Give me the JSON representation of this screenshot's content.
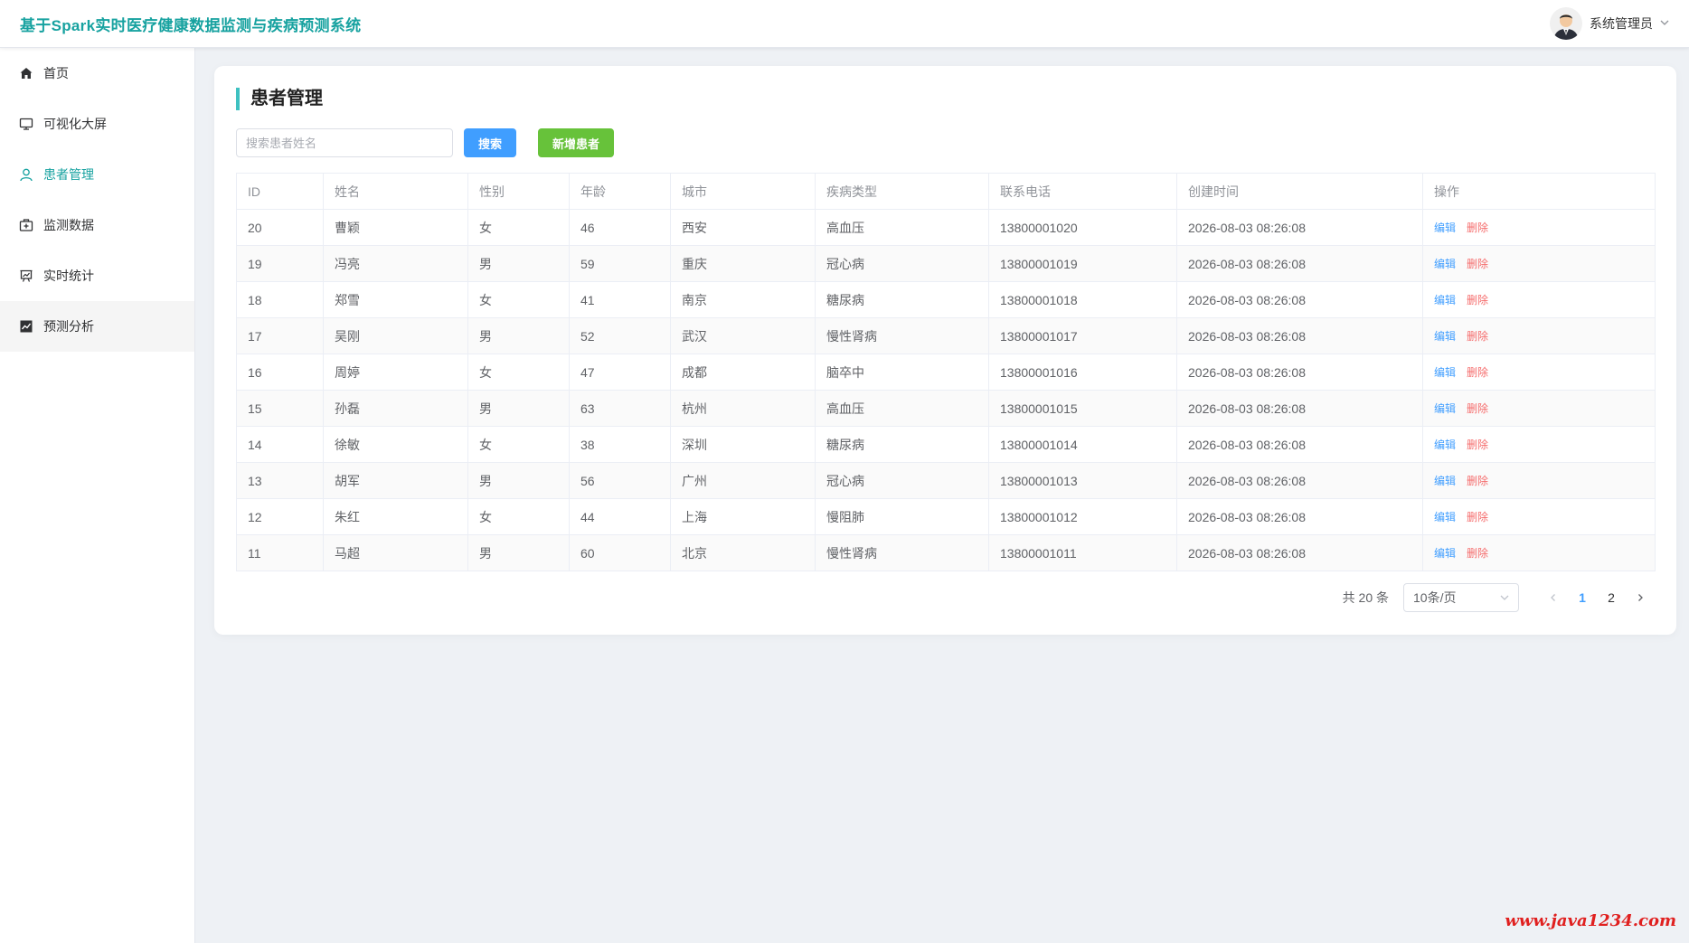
{
  "header": {
    "title": "基于Spark实时医疗健康数据监测与疾病预测系统",
    "user_name": "系统管理员"
  },
  "sidebar": {
    "items": [
      {
        "label": "首页",
        "icon": "home-icon"
      },
      {
        "label": "可视化大屏",
        "icon": "monitor-icon"
      },
      {
        "label": "患者管理",
        "icon": "user-icon"
      },
      {
        "label": "监测数据",
        "icon": "medical-kit-icon"
      },
      {
        "label": "实时统计",
        "icon": "presentation-chart-icon"
      },
      {
        "label": "预测分析",
        "icon": "trend-chart-icon"
      }
    ]
  },
  "main": {
    "page_title": "患者管理",
    "search_placeholder": "搜索患者姓名",
    "search_button": "搜索",
    "add_button": "新增患者",
    "columns": [
      "ID",
      "姓名",
      "性别",
      "年龄",
      "城市",
      "疾病类型",
      "联系电话",
      "创建时间",
      "操作"
    ],
    "rows": [
      [
        "20",
        "曹颖",
        "女",
        "46",
        "西安",
        "高血压",
        "13800001020",
        "2026-08-03 08:26:08"
      ],
      [
        "19",
        "冯亮",
        "男",
        "59",
        "重庆",
        "冠心病",
        "13800001019",
        "2026-08-03 08:26:08"
      ],
      [
        "18",
        "郑雪",
        "女",
        "41",
        "南京",
        "糖尿病",
        "13800001018",
        "2026-08-03 08:26:08"
      ],
      [
        "17",
        "吴刚",
        "男",
        "52",
        "武汉",
        "慢性肾病",
        "13800001017",
        "2026-08-03 08:26:08"
      ],
      [
        "16",
        "周婷",
        "女",
        "47",
        "成都",
        "脑卒中",
        "13800001016",
        "2026-08-03 08:26:08"
      ],
      [
        "15",
        "孙磊",
        "男",
        "63",
        "杭州",
        "高血压",
        "13800001015",
        "2026-08-03 08:26:08"
      ],
      [
        "14",
        "徐敏",
        "女",
        "38",
        "深圳",
        "糖尿病",
        "13800001014",
        "2026-08-03 08:26:08"
      ],
      [
        "13",
        "胡军",
        "男",
        "56",
        "广州",
        "冠心病",
        "13800001013",
        "2026-08-03 08:26:08"
      ],
      [
        "12",
        "朱红",
        "女",
        "44",
        "上海",
        "慢阻肺",
        "13800001012",
        "2026-08-03 08:26:08"
      ],
      [
        "11",
        "马超",
        "男",
        "60",
        "北京",
        "慢性肾病",
        "13800001011",
        "2026-08-03 08:26:08"
      ]
    ],
    "edit_label": "编辑",
    "delete_label": "删除"
  },
  "pagination": {
    "total_text": "共 20 条",
    "page_size": "10条/页",
    "pages": [
      "1",
      "2"
    ],
    "current": "1"
  },
  "watermark": "www.java1234.com",
  "colors": {
    "brand": "#17a2a0",
    "primary": "#409eff",
    "success": "#67c23a",
    "danger": "#f56c6c"
  }
}
